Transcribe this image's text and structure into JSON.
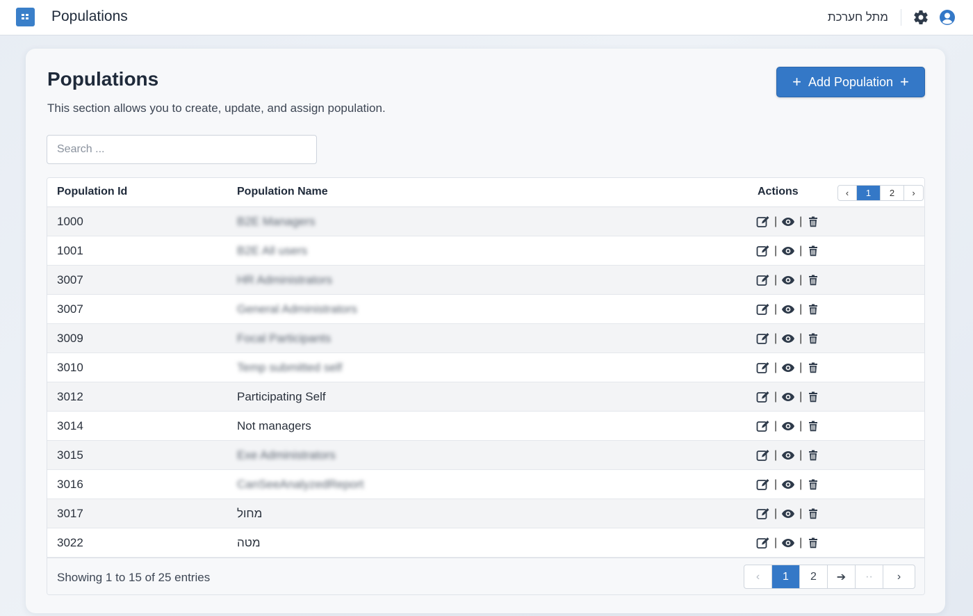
{
  "header": {
    "app_title": "Populations",
    "user_name": "מתל חערכת",
    "brand_color": "#3478c7"
  },
  "main": {
    "title": "Populations",
    "description": "This section allows you to create, update, and assign population.",
    "add_button_label": "Add Population",
    "search": {
      "placeholder": "Search ...",
      "value": ""
    }
  },
  "table": {
    "columns": [
      "Population Id",
      "Population Name",
      "Actions"
    ],
    "top_pager": {
      "prev": "‹",
      "pages": [
        "1",
        "2"
      ],
      "next": "›",
      "current": "1"
    },
    "rows": [
      {
        "id": "1000",
        "name": "B2E Managers",
        "blurred": true
      },
      {
        "id": "1001",
        "name": "B2E All users",
        "blurred": true
      },
      {
        "id": "3007",
        "name": "HR Administrators",
        "blurred": true
      },
      {
        "id": "3007",
        "name": "General Administrators",
        "blurred": true
      },
      {
        "id": "3009",
        "name": "Focal Participants",
        "blurred": true
      },
      {
        "id": "3010",
        "name": "Temp submitted self",
        "blurred": true
      },
      {
        "id": "3012",
        "name": "Participating Self",
        "blurred": false
      },
      {
        "id": "3014",
        "name": "Not managers",
        "blurred": false
      },
      {
        "id": "3015",
        "name": "Exe Administrators",
        "blurred": true
      },
      {
        "id": "3016",
        "name": "CanSeeAnalyzedReport",
        "blurred": true
      },
      {
        "id": "3017",
        "name": "מחול",
        "blurred": false
      },
      {
        "id": "3022",
        "name": "מטה",
        "blurred": false
      }
    ],
    "row_actions": [
      "edit-icon",
      "view-icon",
      "delete-icon"
    ],
    "separator": "|",
    "footer": {
      "showing": "Showing 1 to 15 of 25 entries",
      "pager": {
        "prev": "‹",
        "pages": [
          "1",
          "2"
        ],
        "next_arrow": "➔",
        "ellipsis": "··",
        "last": "›",
        "current": "1"
      }
    }
  }
}
